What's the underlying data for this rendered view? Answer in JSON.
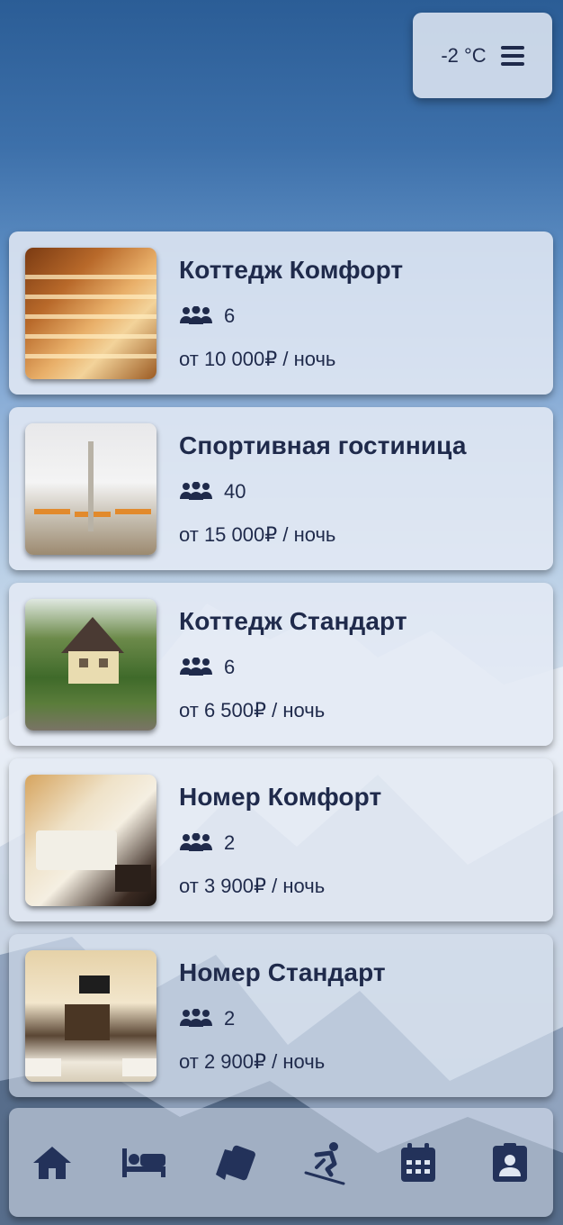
{
  "weather": {
    "temperature": "-2 °C",
    "menu_icon": "bars-icon"
  },
  "listings": [
    {
      "title": "Коттедж Комфорт",
      "guests": "6",
      "price": "от 10 000₽ / ночь",
      "photo": "sauna"
    },
    {
      "title": "Спортивная гостиница",
      "guests": "40",
      "price": "от 15 000₽ / ночь",
      "photo": "hall"
    },
    {
      "title": "Коттедж Стандарт",
      "guests": "6",
      "price": "от 6 500₽ / ночь",
      "photo": "cottage"
    },
    {
      "title": "Номер Комфорт",
      "guests": "2",
      "price": "от 3 900₽ / ночь",
      "photo": "room"
    },
    {
      "title": "Номер Стандарт",
      "guests": "2",
      "price": "от 2 900₽ / ночь",
      "photo": "room"
    }
  ],
  "bottom_nav": [
    {
      "icon": "home-icon"
    },
    {
      "icon": "bed-icon"
    },
    {
      "icon": "ski-pass-cards-icon"
    },
    {
      "icon": "skier-icon"
    },
    {
      "icon": "calendar-icon"
    },
    {
      "icon": "contact-badge-icon"
    }
  ],
  "colors": {
    "text": "#1f2a4b",
    "accent": "#23325a"
  }
}
